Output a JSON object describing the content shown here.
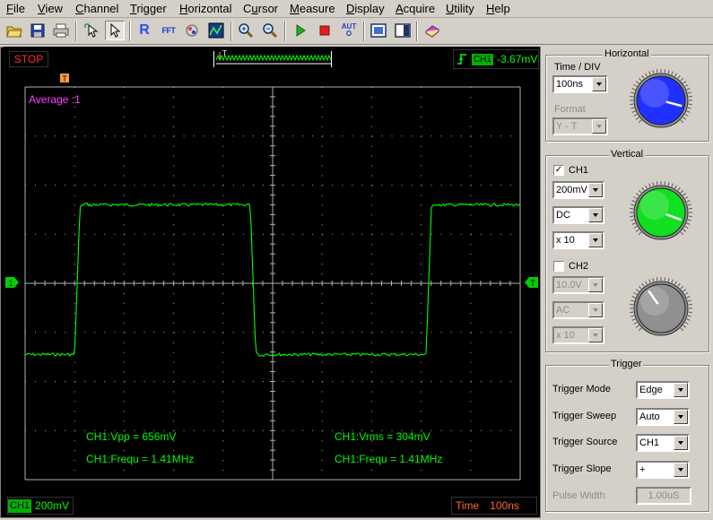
{
  "menu": [
    {
      "label": "File",
      "hot": "F"
    },
    {
      "label": "View",
      "hot": "V"
    },
    {
      "label": "Channel",
      "hot": "C"
    },
    {
      "label": "Trigger",
      "hot": "T"
    },
    {
      "label": "Horizontal",
      "hot": "H"
    },
    {
      "label": "Cursor",
      "hot": "u"
    },
    {
      "label": "Measure",
      "hot": "M"
    },
    {
      "label": "Display",
      "hot": "D"
    },
    {
      "label": "Acquire",
      "hot": "A"
    },
    {
      "label": "Utility",
      "hot": "U"
    },
    {
      "label": "Help",
      "hot": "H"
    }
  ],
  "toolbar": {
    "icons": [
      "open-icon",
      "save-icon",
      "print-icon",
      "cursor-select-icon",
      "pointer-icon",
      "reference-icon",
      "fft-icon",
      "math-icon",
      "persistence-icon",
      "zoom-in-icon",
      "zoom-out-icon",
      "run-icon",
      "stop-icon",
      "auto-icon",
      "screenshot-icon",
      "panel-icon",
      "book-icon"
    ],
    "reference_letter": "R",
    "fft_text": "FFT",
    "auto_text": "AUTO"
  },
  "scope": {
    "run_state": "STOP",
    "acquire_mode": "Average :1",
    "trigger_channel": "CH1",
    "trigger_level": "-3.67mV",
    "ch1_tag": "CH1",
    "ch1_scale": "200mV",
    "ch1_marker": "1",
    "trigger_marker": "T",
    "time_label": "Time",
    "time_scale": "100ns",
    "measurements": [
      {
        "text": "CH1:Vpp = 656mV"
      },
      {
        "text": "CH1:Frequ = 1.41MHz"
      },
      {
        "text": "CH1:Vrms = 304mV"
      },
      {
        "text": "CH1:Frequ = 1.41MHz"
      }
    ],
    "trace_color": "#00ff00",
    "grid_color": "#b0b0b0",
    "waveform": {
      "high_div": 1.6,
      "low_div": -1.45,
      "edges_div": [
        {
          "t": 1.0,
          "dir": "up"
        },
        {
          "t": 4.55,
          "dir": "down"
        },
        {
          "t": 8.1,
          "dir": "up"
        }
      ]
    }
  },
  "horizontal": {
    "title": "Horizontal",
    "timediv_label": "Time / DIV",
    "timediv_value": "100ns",
    "format_label": "Format",
    "format_value": "Y - T",
    "knob_color": "#2030ff"
  },
  "vertical": {
    "title": "Vertical",
    "ch1_label": "CH1",
    "ch1_checked": "✓",
    "ch1_volts": "200mV",
    "ch1_coupling": "DC",
    "ch1_probe": "x 10",
    "ch1_knob_color": "#10e020",
    "ch2_label": "CH2",
    "ch2_volts": "10.0V",
    "ch2_coupling": "AC",
    "ch2_probe": "x 10",
    "ch2_knob_color": "#909090"
  },
  "trigger": {
    "title": "Trigger",
    "mode_label": "Trigger Mode",
    "mode_value": "Edge",
    "sweep_label": "Trigger Sweep",
    "sweep_value": "Auto",
    "source_label": "Trigger Source",
    "source_value": "CH1",
    "slope_label": "Trigger Slope",
    "slope_value": "+",
    "pulse_label": "Pulse Width",
    "pulse_value": "1.00uS"
  }
}
